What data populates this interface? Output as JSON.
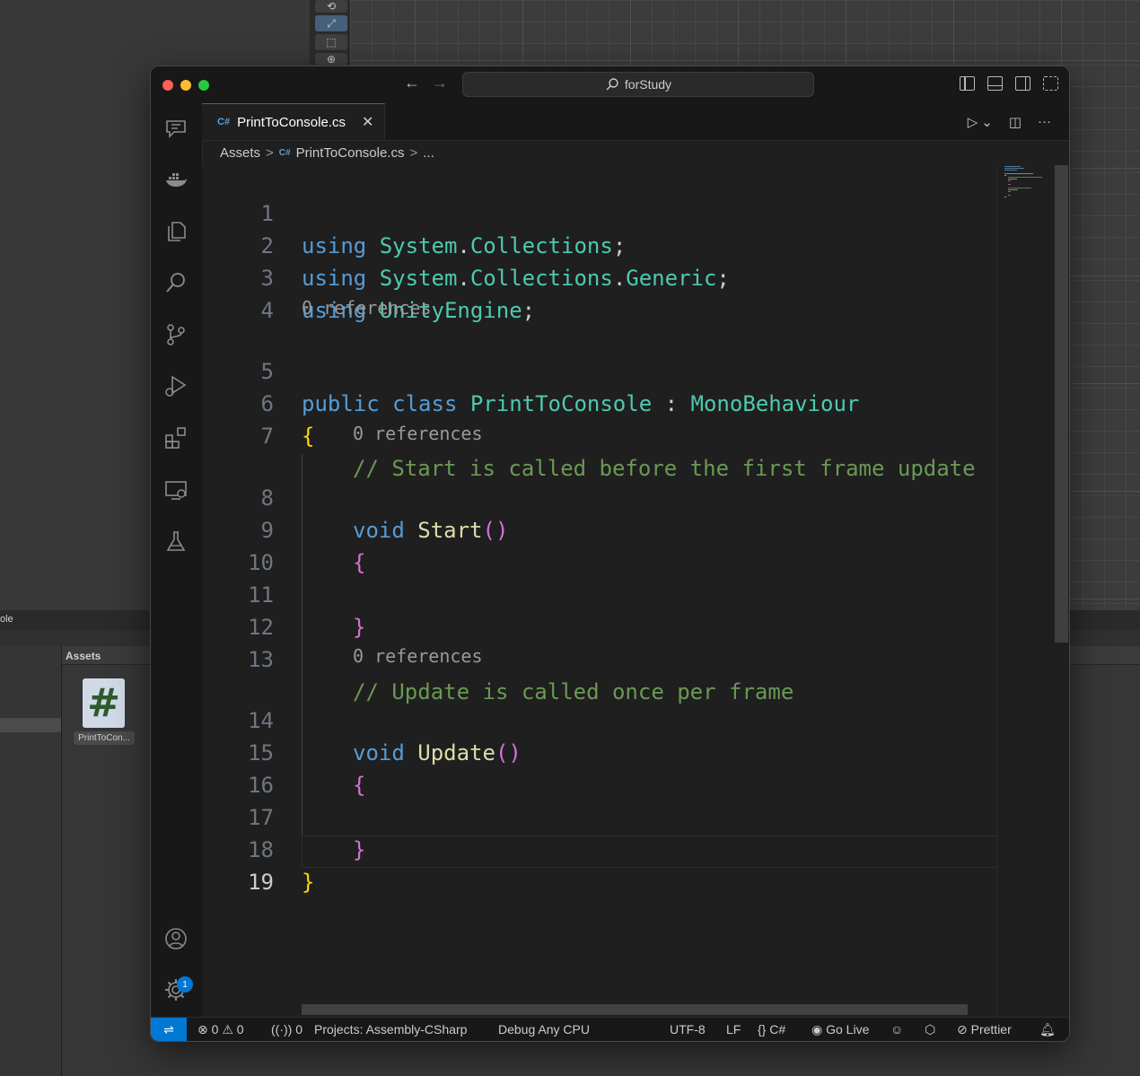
{
  "unity": {
    "console_tab": "ole",
    "assets_title": "Assets",
    "asset_icon_glyph": "#",
    "asset_label": "PrintToCon..."
  },
  "window": {
    "search_text": "forStudy",
    "back_glyph": "←",
    "forward_glyph": "→"
  },
  "tab": {
    "icon_text": "C#",
    "label": "PrintToConsole.cs",
    "close_glyph": "✕"
  },
  "tab_actions": {
    "run": "▷",
    "dropdown": "⌄",
    "split": "◫",
    "more": "···"
  },
  "breadcrumb": {
    "items": [
      "Assets",
      "PrintToConsole.cs",
      "..."
    ],
    "separator": ">"
  },
  "code": {
    "line_numbers": [
      "1",
      "2",
      "3",
      "4",
      "5",
      "6",
      "7",
      "8",
      "9",
      "10",
      "11",
      "12",
      "13",
      "14",
      "15",
      "16",
      "17",
      "18",
      "19"
    ],
    "lines": {
      "l1_kw": "using",
      "l1_ns": "System",
      "l1_dot": ".",
      "l1_ns2": "Collections",
      "l1_end": ";",
      "l2_kw": "using",
      "l2_ns": "System",
      "l2_dot": ".",
      "l2_ns2": "Collections",
      "l2_dot2": ".",
      "l2_ns3": "Generic",
      "l2_end": ";",
      "l3_kw": "using",
      "l3_ns": "UnityEngine",
      "l3_end": ";",
      "l5_kw1": "public",
      "l5_kw2": "class",
      "l5_cls": "PrintToConsole",
      "l5_colon": " : ",
      "l5_base": "MonoBehaviour",
      "l6": "{",
      "l7": "// Start is called before the first frame update",
      "l8_kw": "void",
      "l8_fn": "Start",
      "l8_paren": "()",
      "l9": "{",
      "l11": "}",
      "l13": "// Update is called once per frame",
      "l14_kw": "void",
      "l14_fn": "Update",
      "l14_paren": "()",
      "l15": "{",
      "l17": "}",
      "l18": "}"
    },
    "code_lens": [
      "0 references",
      "0 references",
      "0 references"
    ]
  },
  "accounts_badge": "1",
  "status_bar": {
    "remote_glyph": "⇌",
    "errors": "0",
    "warnings": "0",
    "ports": "0",
    "projects": "Projects: Assembly-CSharp",
    "debug": "Debug Any CPU",
    "encoding": "UTF-8",
    "eol": "LF",
    "language": "C#",
    "go_live": "Go Live",
    "prettier": "Prettier"
  },
  "colors": {
    "accent": "#0078d4",
    "keyword": "#569cd6",
    "type": "#4ec9b0",
    "comment": "#6a9955",
    "function": "#dcdcaa",
    "bracket1": "#ffd700",
    "bracket2": "#da70d6"
  }
}
